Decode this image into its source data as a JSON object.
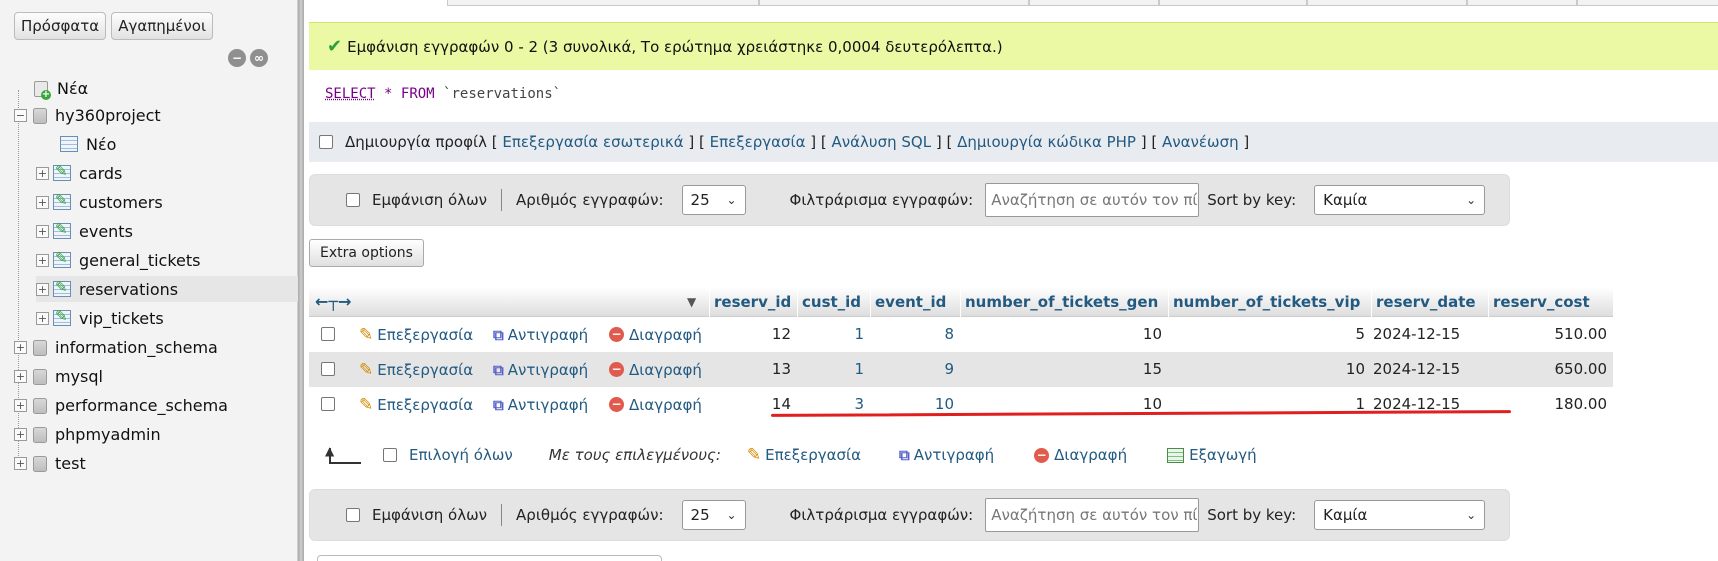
{
  "sidebar": {
    "tabs": [
      "Πρόσφατα",
      "Αγαπημένοι"
    ],
    "tree": [
      {
        "label": "Νέα",
        "kind": "new"
      },
      {
        "label": "hy360project",
        "kind": "db"
      },
      {
        "label": "Νέο",
        "kind": "new-table"
      },
      {
        "label": "cards",
        "kind": "table"
      },
      {
        "label": "customers",
        "kind": "table"
      },
      {
        "label": "events",
        "kind": "table"
      },
      {
        "label": "general_tickets",
        "kind": "table"
      },
      {
        "label": "reservations",
        "kind": "table",
        "selected": true
      },
      {
        "label": "vip_tickets",
        "kind": "table"
      },
      {
        "label": "information_schema",
        "kind": "db"
      },
      {
        "label": "mysql",
        "kind": "db"
      },
      {
        "label": "performance_schema",
        "kind": "db"
      },
      {
        "label": "phpmyadmin",
        "kind": "db"
      },
      {
        "label": "test",
        "kind": "db"
      }
    ]
  },
  "success_message": "Εμφάνιση εγγραφών 0 - 2 (3 συνολικά, Το ερώτημα χρειάστηκε 0,0004 δευτερόλεπτα.)",
  "sql": {
    "select": "SELECT",
    "star": "*",
    "from": "FROM",
    "table": "`reservations`"
  },
  "profile_bar": {
    "label": "Δημιουργία προφίλ",
    "links": [
      "Επεξεργασία εσωτερικά",
      "Επεξεργασία",
      "Ανάλυση SQL",
      "Δημιουργία κώδικα PHP",
      "Ανανέωση"
    ]
  },
  "nav": {
    "show_all": "Εμφάνιση όλων",
    "rows_label": "Αριθμός εγγραφών:",
    "rows_value": "25",
    "filter_label": "Φιλτράρισμα εγγραφών:",
    "filter_placeholder": "Αναζήτηση σε αυτόν τον πίνακα",
    "sort_label": "Sort by key:",
    "sort_value": "Καμία"
  },
  "extra_options": "Extra options",
  "columns": [
    "reserv_id",
    "cust_id",
    "event_id",
    "number_of_tickets_gen",
    "number_of_tickets_vip",
    "reserv_date",
    "reserv_cost"
  ],
  "row_actions": {
    "edit": "Επεξεργασία",
    "copy": "Αντιγραφή",
    "delete": "Διαγραφή"
  },
  "rows": [
    {
      "reserv_id": "12",
      "cust_id": "1",
      "event_id": "8",
      "gen": "10",
      "vip": "5",
      "date": "2024-12-15",
      "cost": "510.00"
    },
    {
      "reserv_id": "13",
      "cust_id": "1",
      "event_id": "9",
      "gen": "15",
      "vip": "10",
      "date": "2024-12-15",
      "cost": "650.00"
    },
    {
      "reserv_id": "14",
      "cust_id": "3",
      "event_id": "10",
      "gen": "10",
      "vip": "1",
      "date": "2024-12-15",
      "cost": "180.00"
    }
  ],
  "bulk": {
    "select_all": "Επιλογή όλων",
    "with_selected": "Με τους επιλεγμένους:",
    "edit": "Επεξεργασία",
    "copy": "Αντιγραφή",
    "delete": "Διαγραφή",
    "export": "Εξαγωγή"
  }
}
